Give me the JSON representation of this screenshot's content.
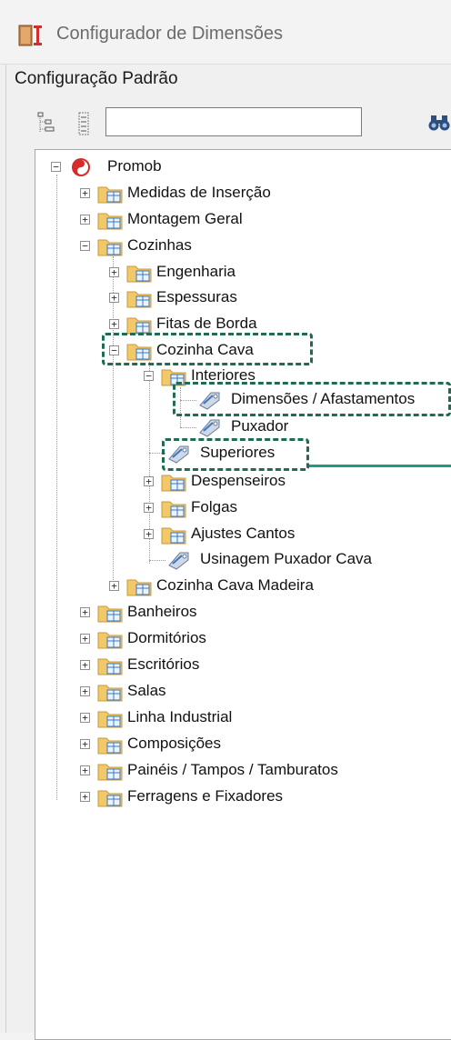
{
  "window": {
    "title": "Configurador de Dimensões"
  },
  "config": {
    "label": "Configuração Padrão"
  },
  "search": {
    "value": ""
  },
  "tree": {
    "root": "Promob",
    "level1": [
      "Medidas de Inserção",
      "Montagem Geral",
      "Cozinhas",
      "Banheiros",
      "Dormitórios",
      "Escritórios",
      "Salas",
      "Linha Industrial",
      "Composições",
      "Painéis / Tampos / Tamburatos",
      "Ferragens e Fixadores"
    ],
    "cozinhas": [
      "Engenharia",
      "Espessuras",
      "Fitas de Borda",
      "Cozinha Cava",
      "Cozinha Cava Madeira"
    ],
    "cozinha_cava": [
      "Interiores",
      "Superiores",
      "Despenseiros",
      "Folgas",
      "Ajustes Cantos",
      "Usinagem Puxador Cava"
    ],
    "interiores": [
      "Dimensões / Afastamentos",
      "Puxador"
    ]
  },
  "colors": {
    "highlight": "#1f6b55",
    "folder": "#f1c86a"
  }
}
